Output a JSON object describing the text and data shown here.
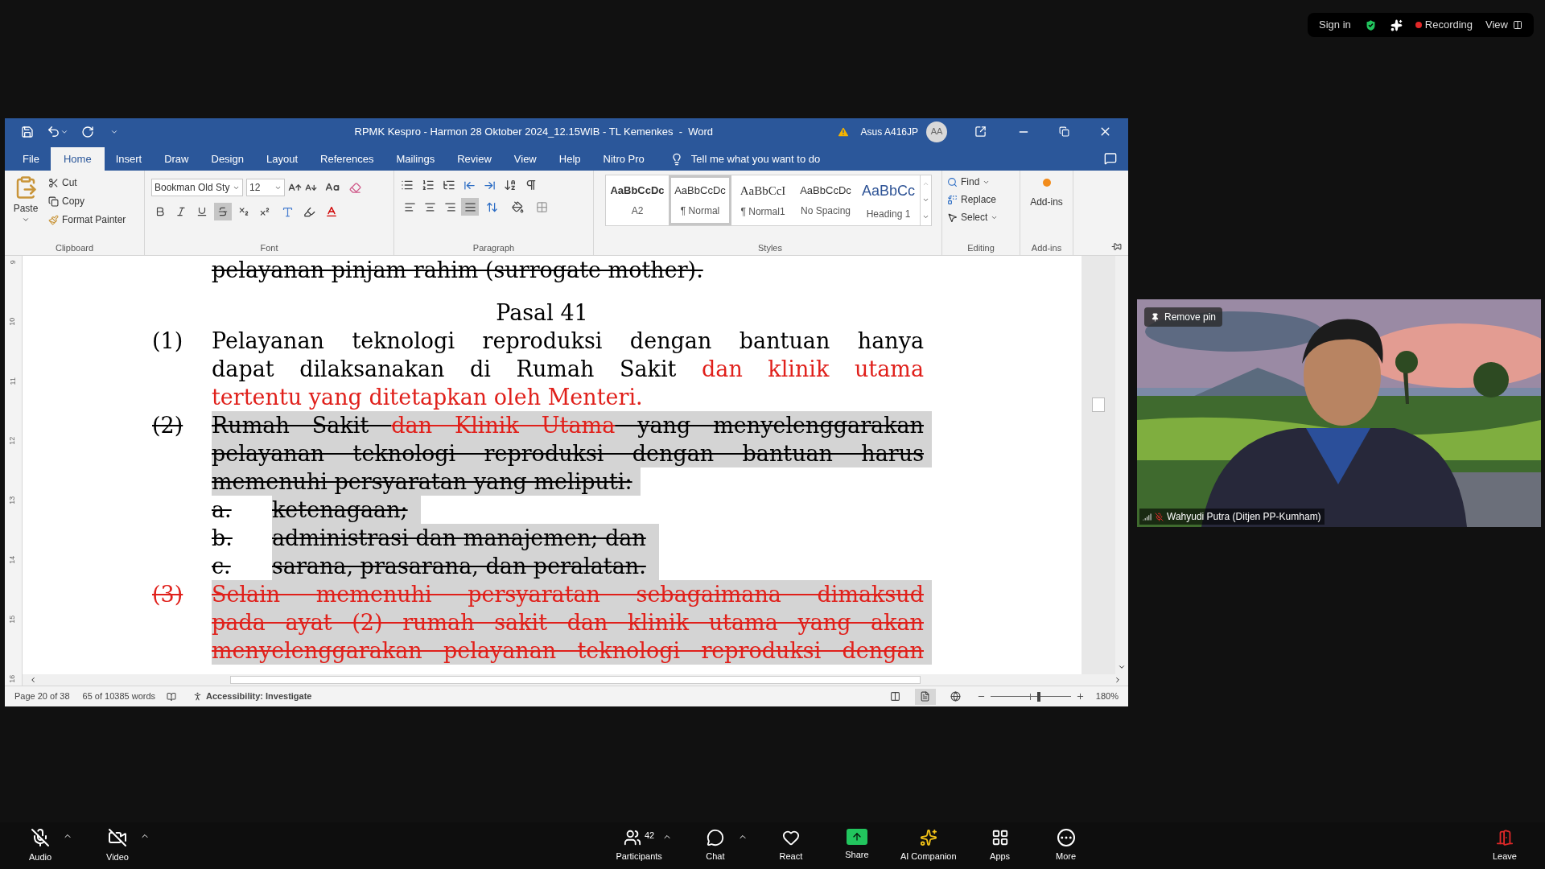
{
  "zoom_top": {
    "sign_in": "Sign in",
    "recording": "Recording",
    "view": "View"
  },
  "word": {
    "title": "RPMK Kespro - Harmon 28 Oktober 2024_12.15WIB - TL Kemenkes  -  Word",
    "account": "Asus A416JP",
    "avatar": "AA",
    "tabs": [
      {
        "label": "File",
        "selected": false
      },
      {
        "label": "Home",
        "selected": true
      },
      {
        "label": "Insert",
        "selected": false
      },
      {
        "label": "Draw",
        "selected": false
      },
      {
        "label": "Design",
        "selected": false
      },
      {
        "label": "Layout",
        "selected": false
      },
      {
        "label": "References",
        "selected": false
      },
      {
        "label": "Mailings",
        "selected": false
      },
      {
        "label": "Review",
        "selected": false
      },
      {
        "label": "View",
        "selected": false
      },
      {
        "label": "Help",
        "selected": false
      },
      {
        "label": "Nitro Pro",
        "selected": false
      }
    ],
    "tell_me": "Tell me what you want to do",
    "clipboard": {
      "paste": "Paste",
      "cut": "Cut",
      "copy": "Copy",
      "format_painter": "Format Painter",
      "label": "Clipboard"
    },
    "font": {
      "name": "Bookman Old Sty",
      "size": "12",
      "label": "Font",
      "toggles": [
        {
          "kind": "bold",
          "active": false
        },
        {
          "kind": "italic",
          "active": false
        },
        {
          "kind": "underline",
          "active": false
        },
        {
          "kind": "strikethrough",
          "active": true
        },
        {
          "kind": "subscript",
          "active": false
        },
        {
          "kind": "superscript",
          "active": false
        }
      ]
    },
    "paragraph": {
      "label": "Paragraph",
      "aligns": [
        {
          "kind": "left",
          "active": false
        },
        {
          "kind": "center",
          "active": false
        },
        {
          "kind": "right",
          "active": false
        },
        {
          "kind": "justify",
          "active": true
        }
      ]
    },
    "styles": {
      "label": "Styles",
      "items": [
        {
          "preview": "AaBbCcDc",
          "name": "A2",
          "kind": "bold",
          "selected": false
        },
        {
          "preview": "AaBbCcDc",
          "name": "¶ Normal",
          "kind": "normal",
          "selected": true
        },
        {
          "preview": "AaBbCcI",
          "name": "¶ Normal1",
          "kind": "serif",
          "selected": false
        },
        {
          "preview": "AaBbCcDc",
          "name": "No Spacing",
          "kind": "normal",
          "selected": false
        },
        {
          "preview": "AaBbCc",
          "name": "Heading 1",
          "kind": "heading",
          "selected": false
        }
      ]
    },
    "editing": {
      "label": "Editing",
      "find": "Find",
      "replace": "Replace",
      "select": "Select"
    },
    "addins": {
      "button": "Add-ins",
      "label": "Add-ins"
    },
    "ruler": [
      "9",
      "10",
      "11",
      "12",
      "13",
      "14",
      "15",
      "16"
    ],
    "document": {
      "top_line": "pelayanan pinjam rahim (surrogate mother).",
      "heading": "Pasal 41",
      "paragraphs": [
        {
          "number": "(1)",
          "struck": false,
          "highlighted": false,
          "continues": false,
          "lines": [
            [
              {
                "text": "Pelayanan teknologi reproduksi dengan bantuan hanya",
                "red": false
              }
            ],
            [
              {
                "text": "dapat dilaksanakan di Rumah Sakit ",
                "red": false
              },
              {
                "text": "dan klinik utama",
                "red": true
              }
            ],
            [
              {
                "text": "tertentu yang ditetapkan oleh Menteri.",
                "red": true
              }
            ]
          ]
        },
        {
          "number": "(2)",
          "struck": true,
          "highlighted": true,
          "continues": false,
          "lines": [
            [
              {
                "text": "Rumah Sakit ",
                "red": false
              },
              {
                "text": "dan Klinik Utama",
                "red": true
              },
              {
                "text": " yang menyelenggarakan",
                "red": false
              }
            ],
            [
              {
                "text": "pelayanan teknologi reproduksi dengan bantuan harus",
                "red": false
              }
            ],
            [
              {
                "text": "memenuhi persyaratan yang meliputi:",
                "red": false
              }
            ]
          ],
          "items": [
            {
              "letter": "a.",
              "text": "ketenagaan;"
            },
            {
              "letter": "b.",
              "text": "administrasi dan manajemen; dan"
            },
            {
              "letter": "c.",
              "text": "sarana, prasarana, dan peralatan."
            }
          ]
        },
        {
          "number": "(3)",
          "struck": true,
          "highlighted": true,
          "continues": true,
          "number_red": true,
          "lines": [
            [
              {
                "text": "Selain memenuhi persyaratan sebagaimana dimaksud",
                "red": true
              }
            ],
            [
              {
                "text": "pada ayat (2) rumah sakit dan klinik utama yang akan",
                "red": true
              }
            ],
            [
              {
                "text": "menyelenggarakan pelayanan teknologi reproduksi dengan",
                "red": true
              }
            ]
          ]
        }
      ]
    },
    "status": {
      "page": "Page 20 of 38",
      "words": "65 of 10385 words",
      "accessibility": "Accessibility: Investigate",
      "zoom": "180%",
      "zoom_level": {
        "level": 0.6
      }
    }
  },
  "video": {
    "remove_pin": "Remove pin",
    "name": "Wahyudi Putra (Ditjen PP-Kumham)",
    "muted": true
  },
  "toolbar": [
    {
      "kind": "audio",
      "label": "Audio",
      "off": true,
      "caret": true
    },
    {
      "kind": "video",
      "label": "Video",
      "off": true,
      "caret": true
    },
    {
      "kind": "participants",
      "label": "Participants",
      "count": "42",
      "caret": true
    },
    {
      "kind": "chat",
      "label": "Chat",
      "caret": true
    },
    {
      "kind": "react",
      "label": "React"
    },
    {
      "kind": "share",
      "label": "Share"
    },
    {
      "kind": "ai",
      "label": "AI Companion"
    },
    {
      "kind": "apps",
      "label": "Apps"
    },
    {
      "kind": "more",
      "label": "More"
    },
    {
      "kind": "leave",
      "label": "Leave"
    }
  ]
}
